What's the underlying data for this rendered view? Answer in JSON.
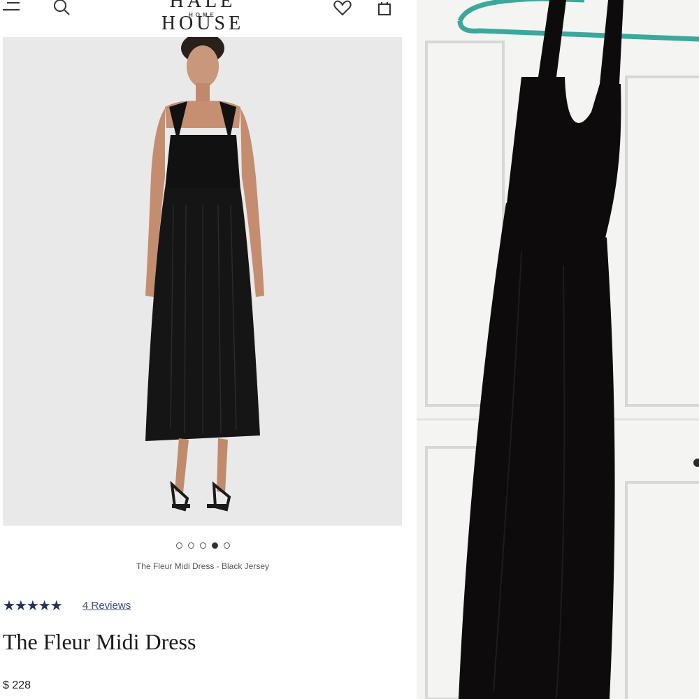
{
  "header": {
    "brand": "HALE HOUSE",
    "brand_sub": "HOME",
    "icons": [
      "menu-icon",
      "search-icon",
      "heart-icon",
      "bag-icon"
    ]
  },
  "gallery": {
    "dot_count": 5,
    "active_index": 3,
    "caption": "The Fleur Midi Dress - Black Jersey"
  },
  "product": {
    "stars": "★★★★★",
    "rating": 5,
    "reviews_link": "4 Reviews",
    "title": "The Fleur Midi Dress",
    "price": "$ 228"
  },
  "colors": {
    "star": "#20335a",
    "hanger": "#3aa99a",
    "door": "#f6f6f4",
    "dress": "#0d0b0b"
  }
}
